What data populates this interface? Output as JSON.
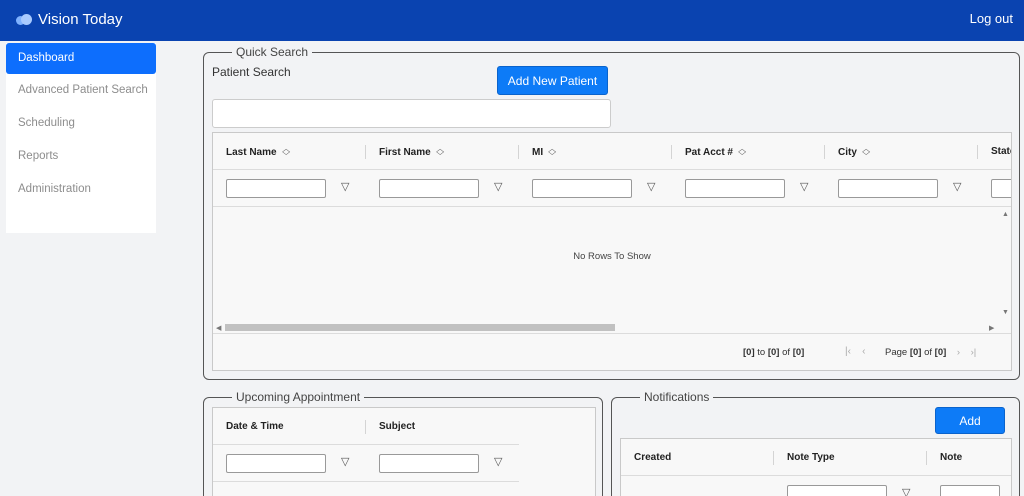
{
  "header": {
    "app_name": "Vision Today",
    "logout_label": "Log out"
  },
  "sidebar": {
    "items": [
      {
        "label": "Dashboard",
        "active": true
      },
      {
        "label": "Advanced Patient Search",
        "active": false
      },
      {
        "label": "Scheduling",
        "active": false
      },
      {
        "label": "Reports",
        "active": false
      },
      {
        "label": "Administration",
        "active": false
      }
    ]
  },
  "quick_search": {
    "legend": "Quick Search",
    "patient_search_label": "Patient Search",
    "search_value": "",
    "add_patient_label": "Add New Patient",
    "columns": [
      "Last Name",
      "First Name",
      "MI",
      "Pat Acct #",
      "City",
      "State"
    ],
    "empty_message": "No Rows To Show",
    "pager": {
      "from_prefix": "[0]",
      "to_word": "to",
      "to_value": "[0]",
      "of_word": "of",
      "total": "[0]",
      "page_word": "Page",
      "page_value": "[0]",
      "page_of_word": "of",
      "page_total": "[0]"
    }
  },
  "appointments": {
    "legend": "Upcoming Appointment",
    "columns": [
      "Date & Time",
      "Subject"
    ]
  },
  "notifications": {
    "legend": "Notifications",
    "add_label": "Add",
    "columns": [
      "Created",
      "Note Type",
      "Note"
    ]
  },
  "colors": {
    "topbar": "#0a43b0",
    "accent": "#0d7bf7"
  }
}
